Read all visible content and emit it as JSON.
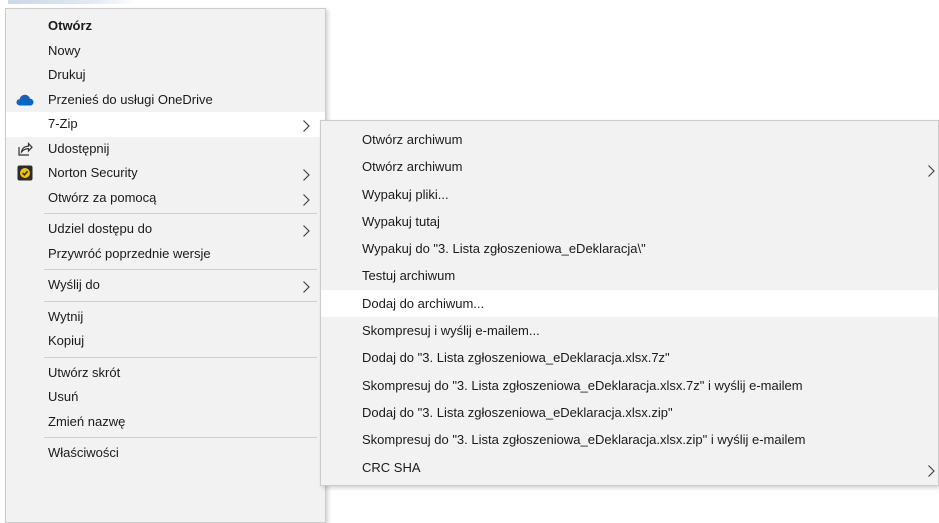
{
  "main_menu": {
    "items": [
      {
        "label": "Otwórz",
        "bold": true
      },
      {
        "label": "Nowy"
      },
      {
        "label": "Drukuj"
      },
      {
        "label": "Przenieś do usługi OneDrive",
        "icon": "onedrive-icon"
      },
      {
        "label": "7-Zip",
        "submenu": true,
        "highlighted": true
      },
      {
        "label": "Udostępnij",
        "icon": "share-icon"
      },
      {
        "label": "Norton Security",
        "icon": "norton-icon",
        "submenu": true
      },
      {
        "label": "Otwórz za pomocą",
        "submenu": true
      },
      {
        "separator": true
      },
      {
        "label": "Udziel dostępu do",
        "submenu": true
      },
      {
        "label": "Przywróć poprzednie wersje"
      },
      {
        "separator": true
      },
      {
        "label": "Wyślij do",
        "submenu": true
      },
      {
        "separator": true
      },
      {
        "label": "Wytnij"
      },
      {
        "label": "Kopiuj"
      },
      {
        "separator": true
      },
      {
        "label": "Utwórz skrót"
      },
      {
        "label": "Usuń"
      },
      {
        "label": "Zmień nazwę"
      },
      {
        "separator": true
      },
      {
        "label": "Właściwości"
      }
    ]
  },
  "submenu_7zip": {
    "items": [
      {
        "label": "Otwórz archiwum"
      },
      {
        "label": "Otwórz archiwum",
        "submenu": true
      },
      {
        "label": "Wypakuj pliki..."
      },
      {
        "label": "Wypakuj tutaj"
      },
      {
        "label": "Wypakuj do \"3. Lista zgłoszeniowa_eDeklaracja\\\""
      },
      {
        "label": "Testuj archiwum"
      },
      {
        "label": "Dodaj do archiwum...",
        "highlighted": true
      },
      {
        "label": "Skompresuj i wyślij e-mailem..."
      },
      {
        "label": "Dodaj do \"3. Lista zgłoszeniowa_eDeklaracja.xlsx.7z\""
      },
      {
        "label": "Skompresuj do \"3. Lista zgłoszeniowa_eDeklaracja.xlsx.7z\" i wyślij e-mailem"
      },
      {
        "label": "Dodaj do \"3. Lista zgłoszeniowa_eDeklaracja.xlsx.zip\""
      },
      {
        "label": "Skompresuj do \"3. Lista zgłoszeniowa_eDeklaracja.xlsx.zip\" i wyślij e-mailem"
      },
      {
        "label": "CRC SHA",
        "submenu": true
      }
    ]
  },
  "colors": {
    "menu_bg": "#f2f2f2",
    "highlight_bg": "#ffffff",
    "separator": "#cfcfcf",
    "onedrive_blue": "#0a66c2",
    "norton_yellow": "#f5c400"
  }
}
